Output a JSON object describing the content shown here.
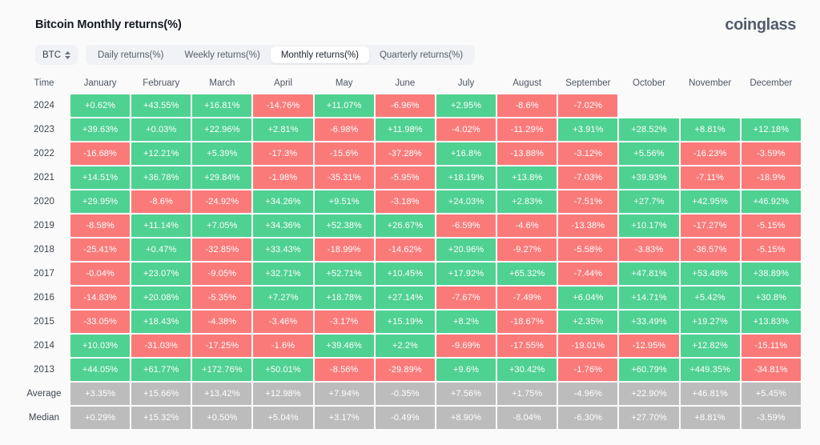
{
  "header": {
    "title": "Bitcoin Monthly returns(%)",
    "brand": "coinglass"
  },
  "controls": {
    "symbol": "BTC",
    "symbol_icon": "updown-chevron-icon",
    "tabs": [
      {
        "label": "Daily returns(%)",
        "active": false
      },
      {
        "label": "Weekly returns(%)",
        "active": false
      },
      {
        "label": "Monthly returns(%)",
        "active": true
      },
      {
        "label": "Quarterly returns(%)",
        "active": false
      }
    ]
  },
  "colors": {
    "positive": "#4fd191",
    "negative": "#fa7a7a",
    "neutral": "#bcbcbc",
    "page_background": "#fafafa",
    "brand_text": "#525c6b"
  },
  "chart_data": {
    "type": "heatmap",
    "title": "Bitcoin Monthly returns(%)",
    "xlabel": "",
    "ylabel": "Time",
    "columns": [
      "Time",
      "January",
      "February",
      "March",
      "April",
      "May",
      "June",
      "July",
      "August",
      "September",
      "October",
      "November",
      "December"
    ],
    "legend": [
      "positive return (green)",
      "negative return (red)",
      "summary statistic (grey)"
    ],
    "rows": [
      {
        "label": "2024",
        "kind": "year",
        "values": [
          "+0.62%",
          "+43.55%",
          "+16.81%",
          "-14.76%",
          "+11.07%",
          "-6.96%",
          "+2.95%",
          "-8.6%",
          "-7.02%",
          "",
          "",
          ""
        ]
      },
      {
        "label": "2023",
        "kind": "year",
        "values": [
          "+39.63%",
          "+0.03%",
          "+22.96%",
          "+2.81%",
          "-6.98%",
          "+11.98%",
          "-4.02%",
          "-11.29%",
          "+3.91%",
          "+28.52%",
          "+8.81%",
          "+12.18%"
        ]
      },
      {
        "label": "2022",
        "kind": "year",
        "values": [
          "-16.68%",
          "+12.21%",
          "+5.39%",
          "-17.3%",
          "-15.6%",
          "-37.28%",
          "+16.8%",
          "-13.88%",
          "-3.12%",
          "+5.56%",
          "-16.23%",
          "-3.59%"
        ]
      },
      {
        "label": "2021",
        "kind": "year",
        "values": [
          "+14.51%",
          "+36.78%",
          "+29.84%",
          "-1.98%",
          "-35.31%",
          "-5.95%",
          "+18.19%",
          "+13.8%",
          "-7.03%",
          "+39.93%",
          "-7.11%",
          "-18.9%"
        ]
      },
      {
        "label": "2020",
        "kind": "year",
        "values": [
          "+29.95%",
          "-8.6%",
          "-24.92%",
          "+34.26%",
          "+9.51%",
          "-3.18%",
          "+24.03%",
          "+2.83%",
          "-7.51%",
          "+27.7%",
          "+42.95%",
          "+46.92%"
        ]
      },
      {
        "label": "2019",
        "kind": "year",
        "values": [
          "-8.58%",
          "+11.14%",
          "+7.05%",
          "+34.36%",
          "+52.38%",
          "+26.67%",
          "-6.59%",
          "-4.6%",
          "-13.38%",
          "+10.17%",
          "-17.27%",
          "-5.15%"
        ]
      },
      {
        "label": "2018",
        "kind": "year",
        "values": [
          "-25.41%",
          "+0.47%",
          "-32.85%",
          "+33.43%",
          "-18.99%",
          "-14.62%",
          "+20.96%",
          "-9.27%",
          "-5.58%",
          "-3.83%",
          "-36.57%",
          "-5.15%"
        ]
      },
      {
        "label": "2017",
        "kind": "year",
        "values": [
          "-0.04%",
          "+23.07%",
          "-9.05%",
          "+32.71%",
          "+52.71%",
          "+10.45%",
          "+17.92%",
          "+65.32%",
          "-7.44%",
          "+47.81%",
          "+53.48%",
          "+38.89%"
        ]
      },
      {
        "label": "2016",
        "kind": "year",
        "values": [
          "-14.83%",
          "+20.08%",
          "-5.35%",
          "+7.27%",
          "+18.78%",
          "+27.14%",
          "-7.67%",
          "-7.49%",
          "+6.04%",
          "+14.71%",
          "+5.42%",
          "+30.8%"
        ]
      },
      {
        "label": "2015",
        "kind": "year",
        "values": [
          "-33.05%",
          "+18.43%",
          "-4.38%",
          "-3.46%",
          "-3.17%",
          "+15.19%",
          "+8.2%",
          "-18.67%",
          "+2.35%",
          "+33.49%",
          "+19.27%",
          "+13.83%"
        ]
      },
      {
        "label": "2014",
        "kind": "year",
        "values": [
          "+10.03%",
          "-31.03%",
          "-17.25%",
          "-1.6%",
          "+39.46%",
          "+2.2%",
          "-9.69%",
          "-17.55%",
          "-19.01%",
          "-12.95%",
          "+12.82%",
          "-15.11%"
        ]
      },
      {
        "label": "2013",
        "kind": "year",
        "values": [
          "+44.05%",
          "+61.77%",
          "+172.76%",
          "+50.01%",
          "-8.56%",
          "-29.89%",
          "+9.6%",
          "+30.42%",
          "-1.76%",
          "+60.79%",
          "+449.35%",
          "-34.81%"
        ]
      },
      {
        "label": "Average",
        "kind": "summary",
        "values": [
          "+3.35%",
          "+15.66%",
          "+13.42%",
          "+12.98%",
          "+7.94%",
          "-0.35%",
          "+7.56%",
          "+1.75%",
          "-4.96%",
          "+22.90%",
          "+46.81%",
          "+5.45%"
        ]
      },
      {
        "label": "Median",
        "kind": "summary",
        "values": [
          "+0.29%",
          "+15.32%",
          "+0.50%",
          "+5.04%",
          "+3.17%",
          "-0.49%",
          "+8.90%",
          "-8.04%",
          "-6.30%",
          "+27.70%",
          "+8.81%",
          "-3.59%"
        ]
      }
    ]
  }
}
